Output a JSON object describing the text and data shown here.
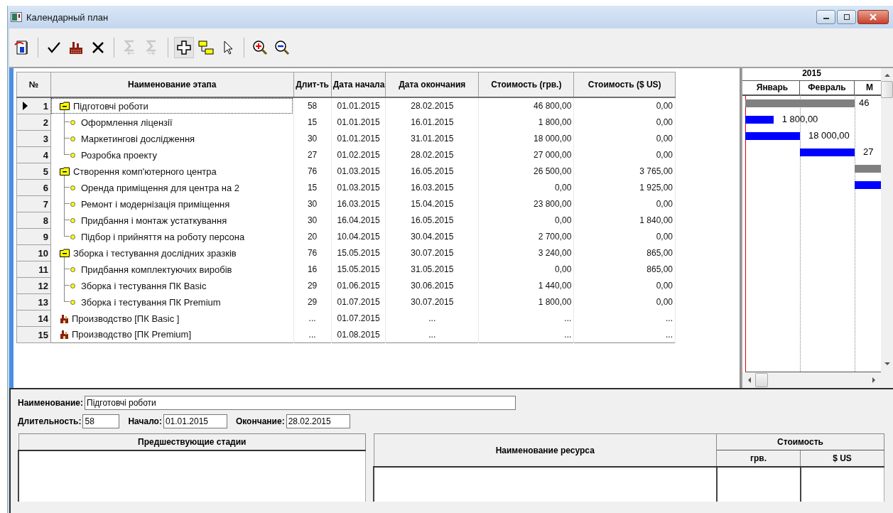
{
  "window": {
    "title": "Календарный план"
  },
  "toolbar": {
    "actions": [
      {
        "disabled": false
      },
      {
        "disabled": false
      },
      {
        "disabled": false
      },
      {
        "disabled": false
      },
      {
        "disabled": true
      },
      {
        "disabled": true
      }
    ],
    "modes": [
      {
        "selected": true
      },
      {
        "selected": false
      },
      {
        "selected": false
      }
    ],
    "zoom": [
      {
        "disabled": false
      },
      {
        "disabled": false
      }
    ]
  },
  "table": {
    "columns": [
      "№",
      "Наименование этапа",
      "Длит-ть",
      "Дата начала",
      "Дата окончания",
      "Стоимость (грв.)",
      "Стоимость ($ US)"
    ],
    "rows": [
      {
        "num": "1",
        "name": "Підготовчі роботи",
        "kind": "group",
        "expanded": true,
        "selected": true,
        "duration": "58",
        "start": "01.01.2015",
        "end": "28.02.2015",
        "cost_uah": "46 800,00",
        "cost_usd": "0,00",
        "chart_label": "46"
      },
      {
        "num": "2",
        "name": "Оформлення ліцензії",
        "kind": "task",
        "selected": false,
        "duration": "15",
        "start": "01.01.2015",
        "end": "16.01.2015",
        "cost_uah": "1 800,00",
        "cost_usd": "0,00",
        "chart_label": "1 800,00"
      },
      {
        "num": "3",
        "name": "Маркетингові дослідження",
        "kind": "task",
        "selected": false,
        "duration": "30",
        "start": "01.01.2015",
        "end": "31.01.2015",
        "cost_uah": "18 000,00",
        "cost_usd": "0,00",
        "chart_label": "18 000,00"
      },
      {
        "num": "4",
        "name": "Розробка проекту",
        "kind": "task",
        "selected": false,
        "duration": "27",
        "start": "01.02.2015",
        "end": "28.02.2015",
        "cost_uah": "27 000,00",
        "cost_usd": "0,00",
        "chart_label": "27"
      },
      {
        "num": "5",
        "name": "Створення комп'ютерного центра",
        "kind": "group",
        "expanded": true,
        "selected": false,
        "duration": "76",
        "start": "01.03.2015",
        "end": "16.05.2015",
        "cost_uah": "26 500,00",
        "cost_usd": "3 765,00"
      },
      {
        "num": "6",
        "name": "Оренда приміщення для центра на 2",
        "kind": "task",
        "selected": false,
        "duration": "15",
        "start": "01.03.2015",
        "end": "16.03.2015",
        "cost_uah": "0,00",
        "cost_usd": "1 925,00"
      },
      {
        "num": "7",
        "name": "Ремонт і модернізація приміщення",
        "kind": "task",
        "selected": false,
        "duration": "30",
        "start": "16.03.2015",
        "end": "15.04.2015",
        "cost_uah": "23 800,00",
        "cost_usd": "0,00"
      },
      {
        "num": "8",
        "name": "Придбання і монтаж устаткування",
        "kind": "task",
        "selected": false,
        "duration": "30",
        "start": "16.04.2015",
        "end": "16.05.2015",
        "cost_uah": "0,00",
        "cost_usd": "1 840,00"
      },
      {
        "num": "9",
        "name": "Підбор і прийняття на роботу персона",
        "kind": "task",
        "selected": false,
        "duration": "20",
        "start": "10.04.2015",
        "end": "30.04.2015",
        "cost_uah": "2 700,00",
        "cost_usd": "0,00"
      },
      {
        "num": "10",
        "name": "Зборка і тестування дослідних зразків",
        "kind": "group",
        "expanded": true,
        "selected": false,
        "duration": "76",
        "start": "15.05.2015",
        "end": "30.07.2015",
        "cost_uah": "3 240,00",
        "cost_usd": "865,00"
      },
      {
        "num": "11",
        "name": "Придбання комплектуючих виробів",
        "kind": "task",
        "selected": false,
        "duration": "16",
        "start": "15.05.2015",
        "end": "31.05.2015",
        "cost_uah": "0,00",
        "cost_usd": "865,00"
      },
      {
        "num": "12",
        "name": "Зборка і тестування ПК Basic",
        "kind": "task",
        "selected": false,
        "duration": "29",
        "start": "01.06.2015",
        "end": "30.06.2015",
        "cost_uah": "1 440,00",
        "cost_usd": "0,00"
      },
      {
        "num": "13",
        "name": "Зборка і тестування ПК Premium",
        "kind": "task",
        "selected": false,
        "duration": "29",
        "start": "01.07.2015",
        "end": "30.07.2015",
        "cost_uah": "1 800,00",
        "cost_usd": "0,00"
      },
      {
        "num": "14",
        "name": "Производство [ПК Basic ]",
        "kind": "production",
        "selected": false,
        "duration": "...",
        "start": "01.07.2015",
        "end": "...",
        "cost_uah": "...",
        "cost_usd": "..."
      },
      {
        "num": "15",
        "name": "Производство [ПК Premium]",
        "kind": "production",
        "selected": false,
        "duration": "...",
        "start": "01.08.2015",
        "end": "...",
        "cost_uah": "...",
        "cost_usd": "..."
      }
    ]
  },
  "gantt": {
    "year": "2015",
    "months": [
      "Январь",
      "Февраль",
      "М"
    ]
  },
  "details": {
    "name_label": "Наименование:",
    "name_value": "Підготовчі роботи",
    "duration_label": "Длительность:",
    "duration_value": "58",
    "start_label": "Начало:",
    "start_value": "01.01.2015",
    "end_label": "Окончание:",
    "end_value": "28.02.2015"
  },
  "predecessors": {
    "header": "Предшествующие стадии"
  },
  "resources": {
    "name_header": "Наименование ресурса",
    "cost_header": "Стоимость",
    "cost_columns": [
      "грв.",
      "$ US"
    ]
  }
}
